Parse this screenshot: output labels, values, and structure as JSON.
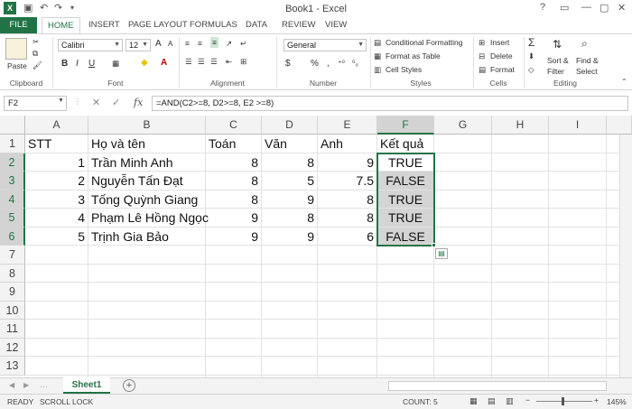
{
  "titlebar": {
    "title": "Book1 - Excel",
    "help": "?"
  },
  "tabs": [
    "FILE",
    "HOME",
    "INSERT",
    "PAGE LAYOUT",
    "FORMULAS",
    "DATA",
    "REVIEW",
    "VIEW"
  ],
  "ribbon": {
    "clipboard": {
      "paste": "Paste",
      "label": "Clipboard"
    },
    "font": {
      "name": "Calibri",
      "size": "12",
      "bold": "B",
      "italic": "I",
      "underline": "U",
      "grow": "A",
      "shrink": "A",
      "label": "Font"
    },
    "alignment": {
      "label": "Alignment"
    },
    "number": {
      "format": "General",
      "currency": "$",
      "percent": "%",
      "comma": ",",
      "label": "Number"
    },
    "styles": {
      "conditional": "Conditional Formatting",
      "table": "Format as Table",
      "cell_styles": "Cell Styles",
      "label": "Styles"
    },
    "cells": {
      "insert": "Insert",
      "delete": "Delete",
      "format": "Format",
      "label": "Cells"
    },
    "editing": {
      "sum": "Σ",
      "sort": "Sort &",
      "sort2": "Filter",
      "find": "Find &",
      "find2": "Select",
      "label": "Editing"
    }
  },
  "formula_bar": {
    "name_box": "F2",
    "cancel": "✕",
    "enter": "✓",
    "fx": "fx",
    "formula": "=AND(C2>=8, D2>=8, E2 >=8)"
  },
  "columns": [
    "A",
    "B",
    "C",
    "D",
    "E",
    "F",
    "G",
    "H",
    "I"
  ],
  "rows": [
    "1",
    "2",
    "3",
    "4",
    "5",
    "6",
    "7",
    "8",
    "9",
    "10",
    "11",
    "12",
    "13"
  ],
  "cells": {
    "r1": [
      "STT",
      "Họ và tên",
      "Toán",
      "Văn",
      "Anh",
      "Kết quả"
    ],
    "r2": [
      "1",
      "Trần Minh Anh",
      "8",
      "8",
      "9",
      "TRUE"
    ],
    "r3": [
      "2",
      "Nguyễn Tấn Đạt",
      "8",
      "5",
      "7.5",
      "FALSE"
    ],
    "r4": [
      "3",
      "Tống Quỳnh Giang",
      "8",
      "9",
      "8",
      "TRUE"
    ],
    "r5": [
      "4",
      "Phạm Lê Hồng Ngọc",
      "9",
      "8",
      "8",
      "TRUE"
    ],
    "r6": [
      "5",
      "Trịnh Gia Bảo",
      "9",
      "9",
      "6",
      "FALSE"
    ]
  },
  "sheets": {
    "active": "Sheet1",
    "add": "+"
  },
  "status": {
    "ready": "READY",
    "scroll_lock": "SCROLL LOCK",
    "count": "COUNT: 5",
    "zoom": "145%"
  },
  "colors": {
    "accent": "#217346",
    "selection": "#d4d4d4"
  }
}
